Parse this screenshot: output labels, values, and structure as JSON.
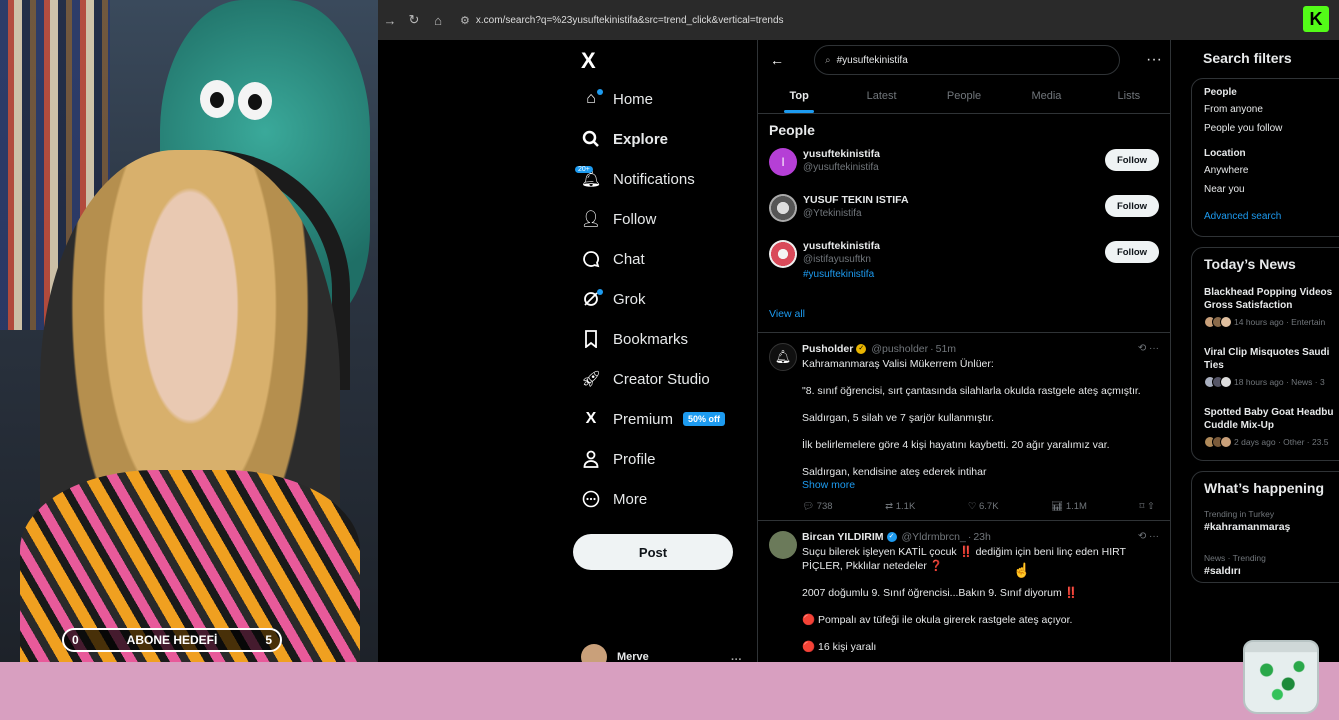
{
  "browser": {
    "url": "x.com/search?q=%23yusuftekinistifa&src=trend_click&vertical=trends",
    "extension_badge": "K"
  },
  "stream_overlay": {
    "goal_label": "ABONE HEDEFİ",
    "goal_current": "0",
    "goal_target": "5"
  },
  "nav": {
    "logo": "X",
    "items": [
      {
        "label": "Home",
        "icon": "home-icon"
      },
      {
        "label": "Explore",
        "icon": "search-icon"
      },
      {
        "label": "Notifications",
        "icon": "bell-icon",
        "badge": "20+"
      },
      {
        "label": "Follow",
        "icon": "add-person-icon"
      },
      {
        "label": "Chat",
        "icon": "chat-bubble-icon"
      },
      {
        "label": "Grok",
        "icon": "grok-icon"
      },
      {
        "label": "Bookmarks",
        "icon": "bookmark-icon"
      },
      {
        "label": "Creator Studio",
        "icon": "rocket-icon"
      },
      {
        "label": "Premium",
        "icon": "x-icon",
        "badge": "50% off"
      },
      {
        "label": "Profile",
        "icon": "person-icon"
      },
      {
        "label": "More",
        "icon": "more-circle-icon"
      }
    ],
    "post_label": "Post",
    "account_name": "Merve",
    "account_more": "···"
  },
  "search": {
    "query": "#yusuftekinistifa",
    "more": "···",
    "tabs": [
      "Top",
      "Latest",
      "People",
      "Media",
      "Lists"
    ],
    "active_tab": "Top"
  },
  "people": {
    "title": "People",
    "items": [
      {
        "name": "yusuftekinistifa",
        "handle": "@yusuftekinistifa",
        "tag": "",
        "avatar_color": "#b53fd6",
        "avatar_letter": "I",
        "follow": "Follow"
      },
      {
        "name": "YUSUF TEKIN ISTIFA",
        "handle": "@Ytekinistifa",
        "tag": "",
        "avatar_color": "#8a8f94",
        "avatar_letter": "",
        "follow": "Follow"
      },
      {
        "name": "yusuftekinistifa",
        "handle": "@istifayusuftkn",
        "tag": "#yusuftekinistifa",
        "avatar_color": "#d94a5a",
        "avatar_letter": "",
        "follow": "Follow"
      }
    ],
    "view_all": "View all"
  },
  "tweets": [
    {
      "name": "Pusholder",
      "handle": "@pusholder",
      "time": "51m",
      "verified_color": "#e8b400",
      "avatar_color": "#101010",
      "lines": [
        "Kahramanmaraş Valisi Mükerrem Ünlüer:",
        "",
        "\"8. sınıf öğrencisi, sırt çantasında silahlarla okulda rastgele ateş açmıştır.",
        "",
        "Saldırgan, 5 silah ve 7 şarjör kullanmıştır.",
        "",
        "İlk belirlemelere göre 4 kişi hayatını kaybetti. 20 ağır yaralımız var.",
        "",
        "Saldırgan, kendisine ateş ederek intihar"
      ],
      "show_more": "Show more",
      "stats": {
        "replies": "738",
        "reposts": "1.1K",
        "likes": "6.7K",
        "views": "1.1M"
      }
    },
    {
      "name": "Bircan YILDIRIM",
      "handle": "@Yldrmbrcn_",
      "time": "23h",
      "verified_color": "#1d9bf0",
      "avatar_color": "#6b7a5a",
      "lines": [
        "Suçu bilerek işleyen KATİL çocuk ‼️ dediğim için beni linç eden HIRT",
        "PİÇLER, Pkklılar netedeler ❓",
        "",
        "2007 doğumlu 9. Sınıf öğrencisi...Bakın 9. Sınıf diyorum ‼️",
        "",
        "🔴 Pompalı av tüfeği ile okula girerek rastgele ateş açıyor.",
        "",
        "🔴 16 kişi yaralı"
      ]
    }
  ],
  "sidebar": {
    "filters_title": "Search filters",
    "people_label": "People",
    "people_options": [
      "From anyone",
      "People you follow"
    ],
    "location_label": "Location",
    "location_options": [
      "Anywhere",
      "Near you"
    ],
    "advanced": "Advanced search",
    "news_title": "Today’s News",
    "news": [
      {
        "title1": "Blackhead Popping Videos",
        "title2": "Gross Satisfaction",
        "meta": "14 hours ago · Entertain"
      },
      {
        "title1": "Viral Clip Misquotes Saudi",
        "title2": "Ties",
        "meta": "18 hours ago · News · 3"
      },
      {
        "title1": "Spotted Baby Goat Headbu",
        "title2": "Cuddle Mix-Up",
        "meta": "2 days ago · Other · 23.5"
      }
    ],
    "happening_title": "What’s happening",
    "trends": [
      {
        "meta": "Trending in Turkey",
        "tag": "#kahramanmaraş"
      },
      {
        "meta": "News · Trending",
        "tag": "#saldırı"
      }
    ]
  },
  "colors": {
    "accent": "#1d9bf0",
    "background": "#000000",
    "border": "#2f3336",
    "bottom_strip": "#d89fc0",
    "kick_green": "#53fc18"
  }
}
